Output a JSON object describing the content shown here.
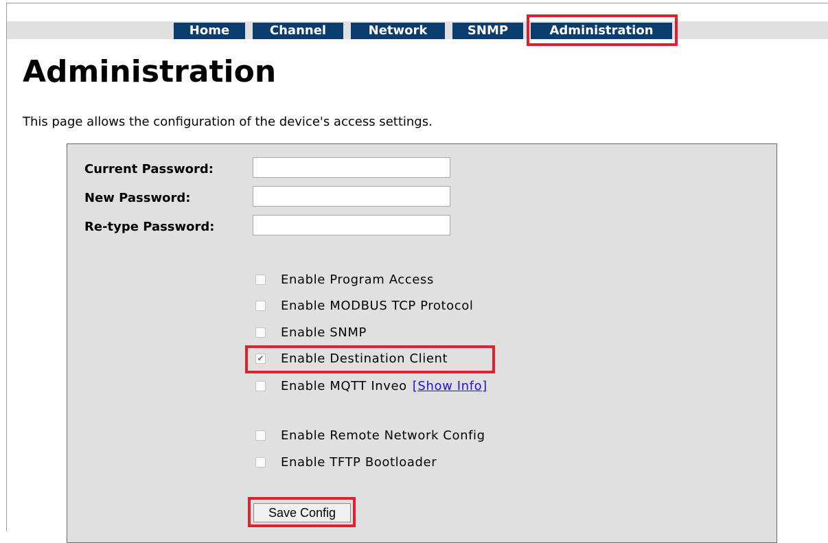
{
  "nav": {
    "tabs": [
      {
        "label": "Home"
      },
      {
        "label": "Channel"
      },
      {
        "label": "Network"
      },
      {
        "label": "SNMP"
      },
      {
        "label": "Administration",
        "active": true
      }
    ]
  },
  "page": {
    "title": "Administration",
    "description": "This page allows the configuration of the device's access settings."
  },
  "form": {
    "password_fields": [
      {
        "label": "Current Password:",
        "value": ""
      },
      {
        "label": "New Password:",
        "value": ""
      },
      {
        "label": "Re-type Password:",
        "value": ""
      }
    ],
    "checkboxes": [
      {
        "label": "Enable Program Access",
        "checked": false
      },
      {
        "label": "Enable MODBUS TCP Protocol",
        "checked": false
      },
      {
        "label": "Enable SNMP",
        "checked": false
      },
      {
        "label": "Enable Destination Client",
        "checked": true
      },
      {
        "label": "Enable MQTT Inveo",
        "checked": false,
        "link": "[Show Info]"
      },
      {
        "label": "Enable Remote Network Config",
        "checked": false
      },
      {
        "label": "Enable TFTP Bootloader",
        "checked": false
      }
    ],
    "save_label": "Save Config",
    "check_glyph": "✔"
  },
  "colors": {
    "tab_bg": "#0a3d6e",
    "highlight": "#e0202e",
    "link": "#1a0dff",
    "panel_bg": "#e0e0e0"
  }
}
